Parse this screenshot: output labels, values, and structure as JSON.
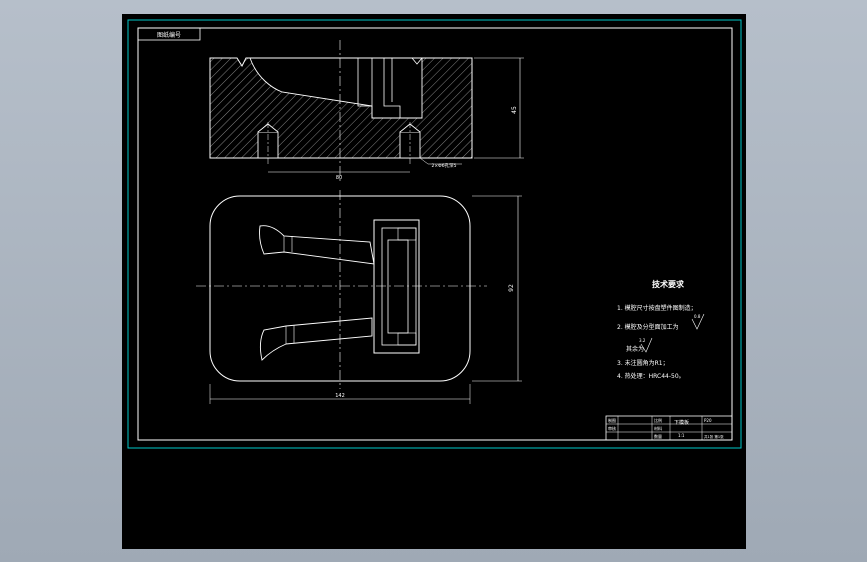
{
  "drawing_no_box": "图纸编号",
  "dimensions": {
    "height_right": "45",
    "hole_label": "2×Φ6孔深5",
    "center_distance": "80",
    "width_bottom": "142",
    "height_plan": "92"
  },
  "tech_requirements": {
    "title": "技术要求",
    "items": [
      "1. 模腔尺寸按盘塑件图制造；",
      "2. 模腔及分型面加工为",
      "其余为",
      "3. 未注圆角为R1；",
      "4. 热处理：HRC44-50。"
    ],
    "roughness_1": "0.8",
    "roughness_2": "3.2"
  },
  "title_block": {
    "part_name": "下模板",
    "material": "P20",
    "scale": "1:1",
    "sheet": "共1张 第1张",
    "cells": [
      "制图",
      "审核",
      "比例",
      "材料",
      "数量",
      "1:1"
    ]
  },
  "colors": {
    "background": "#000000",
    "lines": "#ffffff",
    "border": "#00c8c8",
    "outer": "#a9b2bd"
  }
}
